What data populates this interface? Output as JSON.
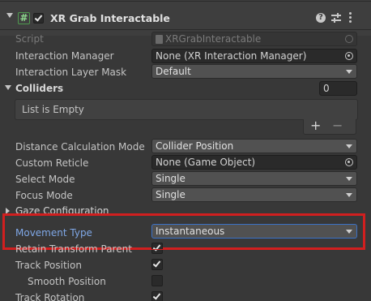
{
  "header": {
    "component_title": "XR Grab Interactable",
    "enabled": true
  },
  "rows": {
    "script": {
      "label": "Script",
      "value": "XRGrabInteractable"
    },
    "interaction_manager": {
      "label": "Interaction Manager",
      "value": "None (XR Interaction Manager)"
    },
    "interaction_layer_mask": {
      "label": "Interaction Layer Mask",
      "value": "Default"
    },
    "colliders": {
      "label": "Colliders",
      "count": "0",
      "empty_text": "List is Empty",
      "add_label": "+",
      "remove_label": "−"
    },
    "distance_calculation_mode": {
      "label": "Distance Calculation Mode",
      "value": "Collider Position"
    },
    "custom_reticle": {
      "label": "Custom Reticle",
      "value": "None (Game Object)"
    },
    "select_mode": {
      "label": "Select Mode",
      "value": "Single"
    },
    "focus_mode": {
      "label": "Focus Mode",
      "value": "Single"
    },
    "gaze_configuration": {
      "label": "Gaze Configuration"
    },
    "movement_type": {
      "label": "Movement Type",
      "value": "Instantaneous"
    },
    "retain_transform_parent": {
      "label": "Retain Transform Parent",
      "checked": true
    },
    "track_position": {
      "label": "Track Position",
      "checked": true
    },
    "smooth_position": {
      "label": "Smooth Position",
      "checked": false
    },
    "track_rotation": {
      "label": "Track Rotation",
      "checked": true
    }
  },
  "colors": {
    "background": "#383838",
    "highlight_box": "#d11f1f",
    "highlight_label": "#7fa7e6"
  }
}
